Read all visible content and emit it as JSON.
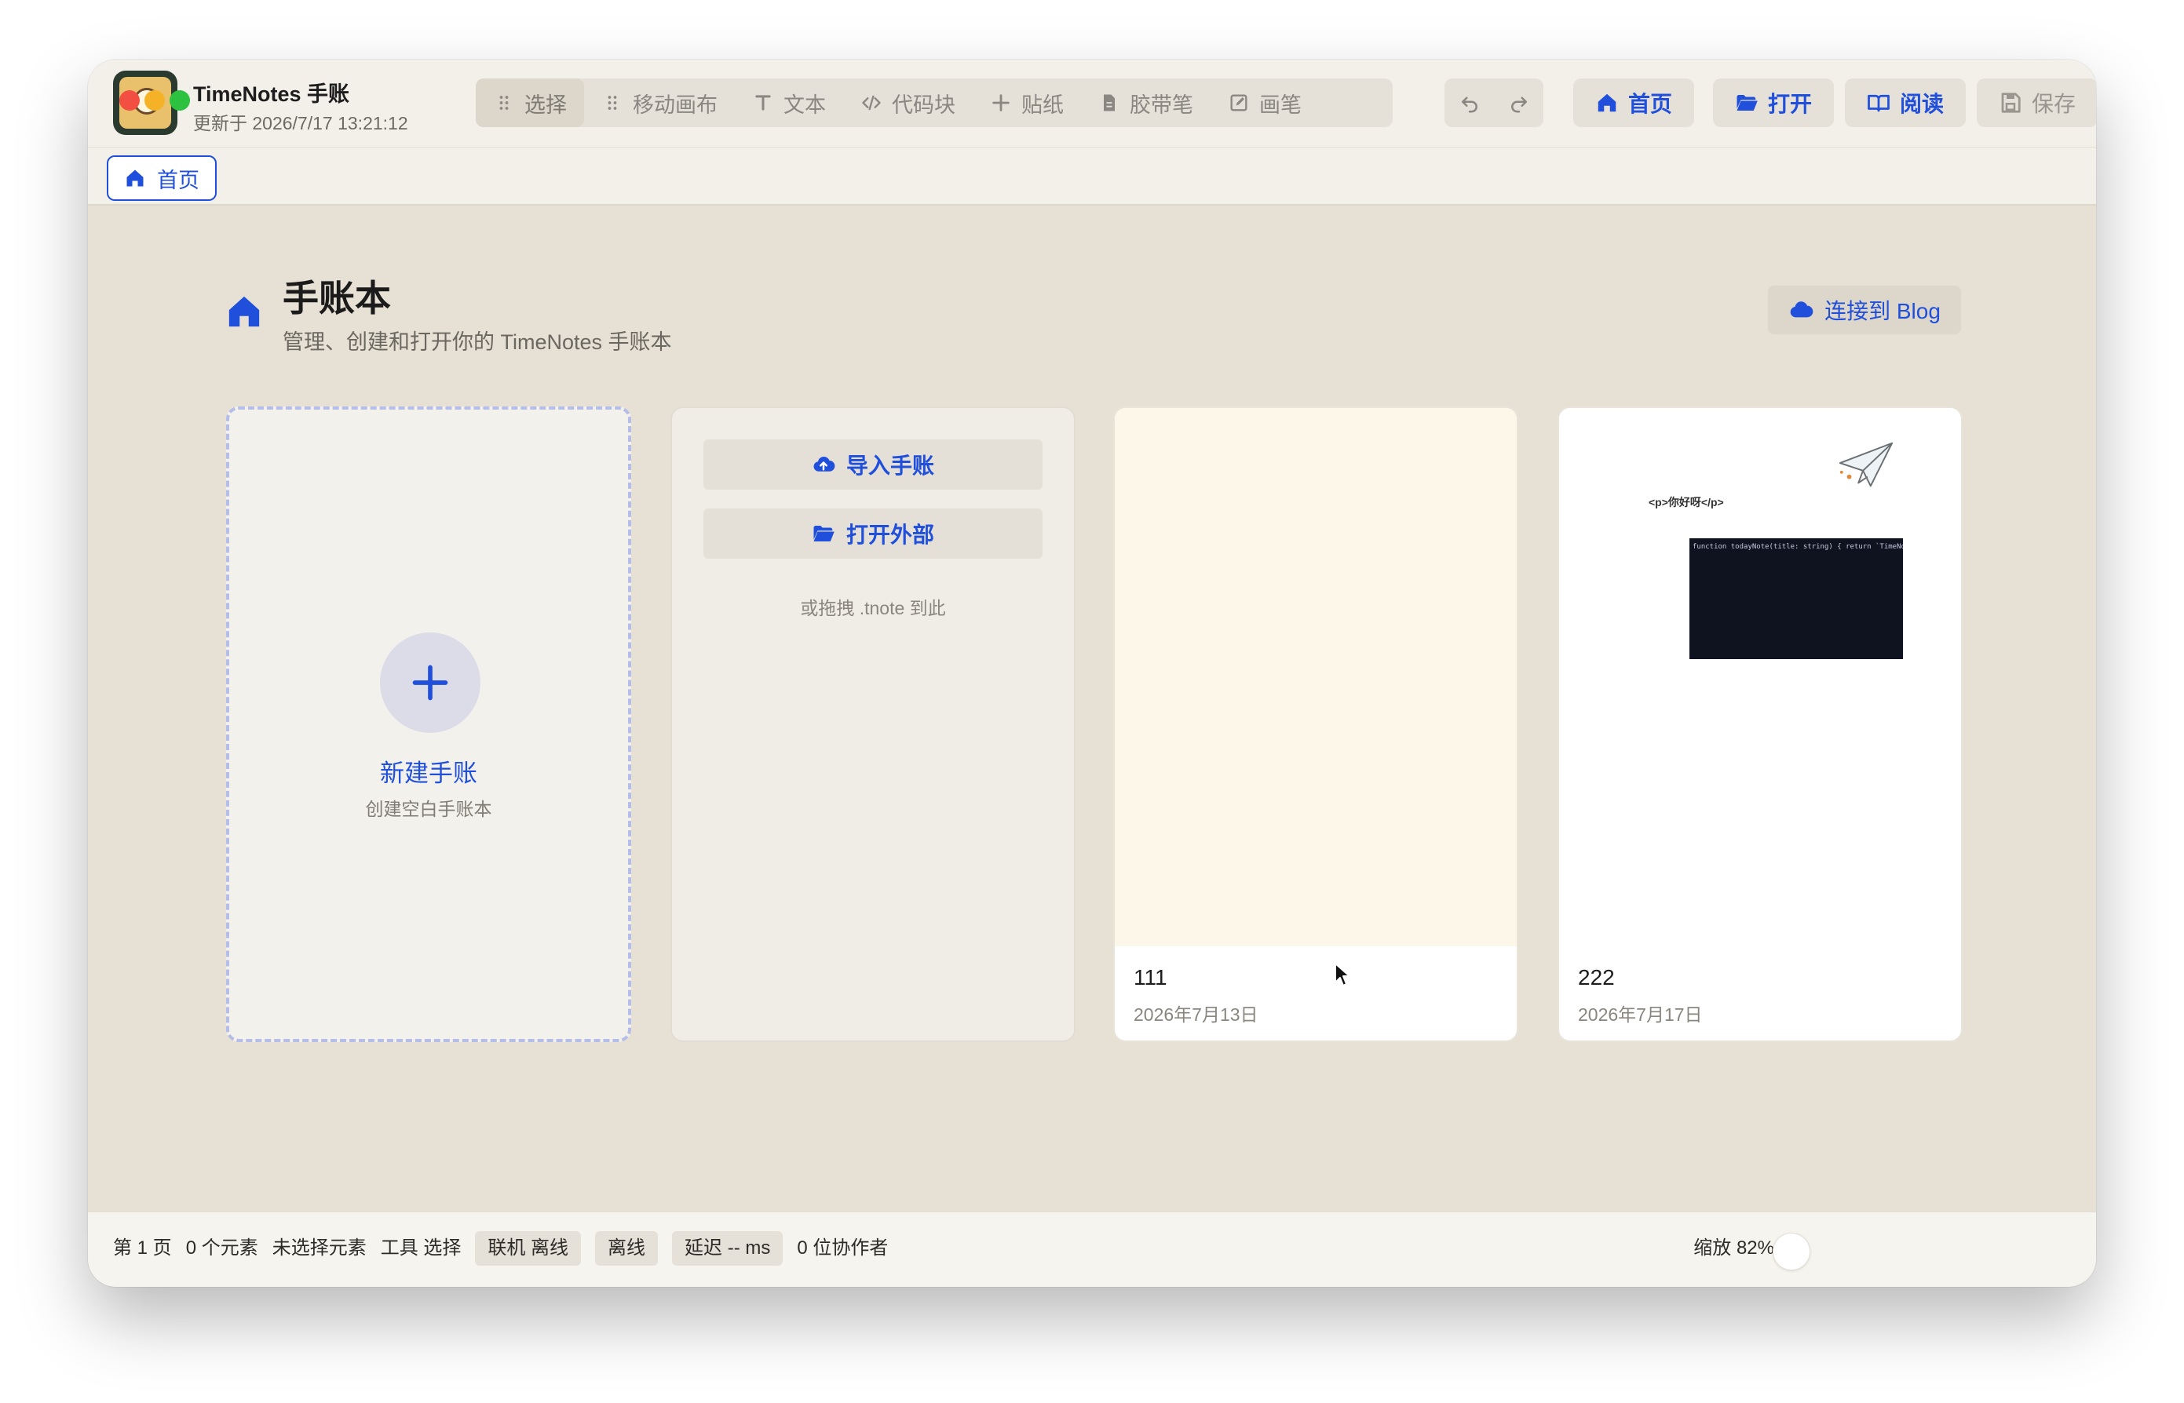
{
  "app": {
    "title": "TimeNotes 手账",
    "updated": "更新于 2026/7/17 13:21:12"
  },
  "toolbar": {
    "tools": [
      {
        "label": "选择",
        "icon": "grip-icon"
      },
      {
        "label": "移动画布",
        "icon": "grip-icon"
      },
      {
        "label": "文本",
        "icon": "text-icon"
      },
      {
        "label": "代码块",
        "icon": "code-icon"
      },
      {
        "label": "贴纸",
        "icon": "plus-icon"
      },
      {
        "label": "胶带笔",
        "icon": "file-icon"
      },
      {
        "label": "画笔",
        "icon": "edit-icon"
      }
    ],
    "home_label": "首页",
    "open_label": "打开",
    "read_label": "阅读",
    "save_label": "保存"
  },
  "tabs": [
    {
      "label": "首页"
    }
  ],
  "main": {
    "title": "手账本",
    "description": "管理、创建和打开你的 TimeNotes 手账本",
    "blog_button": "连接到 Blog",
    "new_card": {
      "label": "新建手账",
      "sub": "创建空白手账本"
    },
    "import_card": {
      "import_label": "导入手账",
      "open_external_label": "打开外部",
      "drop_hint": "或拖拽 .tnote 到此"
    },
    "notebooks": [
      {
        "name": "111",
        "date": "2026年7月13日",
        "preview_bg": "#fdf7e9"
      },
      {
        "name": "222",
        "date": "2026年7月17日",
        "preview_bg": "#ffffff",
        "preview_html": "<p>你好呀</p>",
        "preview_code": "function todayNote(title: string) { return `TimeNotes: ${title}`; }"
      }
    ]
  },
  "status": {
    "page": "第 1 页",
    "elements": "0 个元素",
    "selection": "未选择元素",
    "tool": "工具 选择",
    "online": "联机 离线",
    "offline": "离线",
    "latency": "延迟 -- ms",
    "collaborators": "0 位协作者",
    "zoom": "缩放 82%"
  },
  "colors": {
    "accent": "#1f4fdb",
    "canvas": "#e7e1d5"
  }
}
